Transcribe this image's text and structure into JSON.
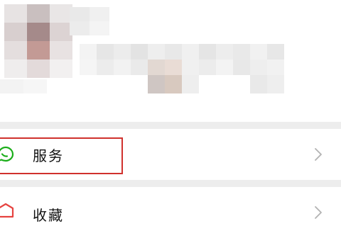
{
  "colors": {
    "accent_green": "#1aad19",
    "highlight_red": "#d0312d",
    "separator": "#ededed",
    "chevron": "#b2b2b2"
  },
  "profile": {
    "obscured": true
  },
  "menu": {
    "items": [
      {
        "label": "服务",
        "icon": "service-icon",
        "highlighted": true
      },
      {
        "label": "收藏",
        "icon": "favorites-icon",
        "highlighted": false
      }
    ]
  }
}
